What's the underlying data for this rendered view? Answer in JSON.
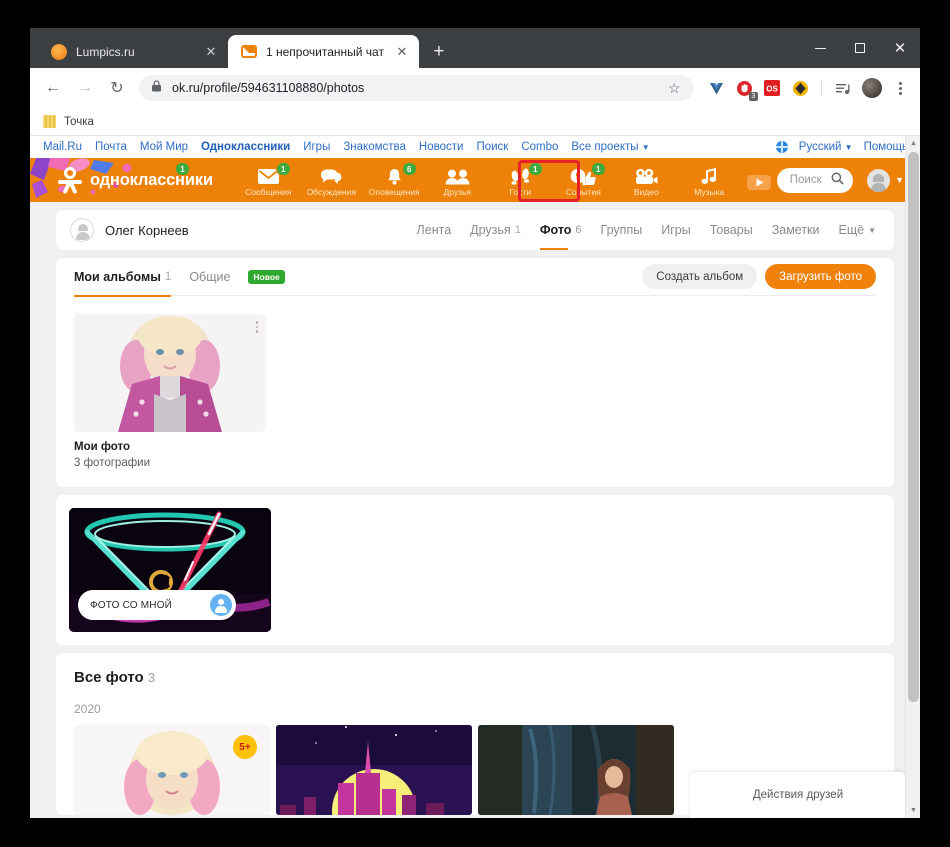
{
  "browser": {
    "tabs": [
      {
        "title": "Lumpics.ru",
        "favicon": "lumpics-favicon",
        "active": false,
        "close_label": "✕"
      },
      {
        "title": "1 непрочитанный чат",
        "favicon": "mail-envelope-favicon",
        "active": true,
        "close_label": "✕"
      }
    ],
    "new_tab_label": "+",
    "window_controls": {
      "minimize": "—",
      "maximize": "❐",
      "close": "✕"
    },
    "toolbar": {
      "back": "←",
      "forward": "→",
      "reload": "↻",
      "url": "ok.ru/profile/594631108880/photos",
      "lock_icon": "lock-icon",
      "star_icon": "☆",
      "extensions": [
        {
          "name": "vue-devtools-extension",
          "badge": ""
        },
        {
          "name": "adblock-extension",
          "badge": "3"
        },
        {
          "name": "os-extension",
          "badge": ""
        },
        {
          "name": "evernote-extension",
          "badge": ""
        }
      ],
      "media_icon": "media-list-icon",
      "menu_icon": "three-dot-menu-icon"
    },
    "bookmarks": [
      {
        "label": "Точка"
      }
    ]
  },
  "mailru_bar": {
    "links": [
      {
        "label": "Mail.Ru",
        "bold": false
      },
      {
        "label": "Почта",
        "bold": false
      },
      {
        "label": "Мой Мир",
        "bold": false
      },
      {
        "label": "Одноклассники",
        "bold": true
      },
      {
        "label": "Игры",
        "bold": false
      },
      {
        "label": "Знакомства",
        "bold": false
      },
      {
        "label": "Новости",
        "bold": false
      },
      {
        "label": "Поиск",
        "bold": false
      },
      {
        "label": "Combo",
        "bold": false
      },
      {
        "label": "Все проекты",
        "bold": false
      }
    ],
    "all_projects_caret": "▼",
    "language": "Русский",
    "language_caret": "▼",
    "help": "Помощь"
  },
  "ok_header": {
    "logo_text": "одноклассники",
    "logo_badge": "1",
    "nav": [
      {
        "label": "Сообщения",
        "icon": "envelope-icon",
        "badge": "1"
      },
      {
        "label": "Обсуждения",
        "icon": "chat-bubble-icon",
        "badge": ""
      },
      {
        "label": "Оповещения",
        "icon": "bell-icon",
        "badge": "6"
      },
      {
        "label": "Друзья",
        "icon": "people-icon",
        "badge": ""
      },
      {
        "label": "Гости",
        "icon": "footprints-icon",
        "badge": "1"
      },
      {
        "label": "События",
        "icon": "events-thumbsup-icon",
        "badge": "1"
      },
      {
        "label": "Видео",
        "icon": "video-camera-icon",
        "badge": ""
      },
      {
        "label": "Музыка",
        "icon": "music-note-icon",
        "badge": ""
      }
    ],
    "play_icon": "play-button-icon",
    "search_placeholder": "Поиск",
    "search_icon": "search-icon",
    "user_caret": "▼",
    "highlight_target": "События",
    "highlight_color": "#e8202a",
    "brand_color": "#ee8208"
  },
  "profile": {
    "name": "Олег Корнеев",
    "tabs": [
      {
        "label": "Лента",
        "count": "",
        "active": false,
        "caret": ""
      },
      {
        "label": "Друзья",
        "count": "1",
        "active": false,
        "caret": ""
      },
      {
        "label": "Фото",
        "count": "6",
        "active": true,
        "caret": ""
      },
      {
        "label": "Группы",
        "count": "",
        "active": false,
        "caret": ""
      },
      {
        "label": "Игры",
        "count": "",
        "active": false,
        "caret": ""
      },
      {
        "label": "Товары",
        "count": "",
        "active": false,
        "caret": ""
      },
      {
        "label": "Заметки",
        "count": "",
        "active": false,
        "caret": ""
      },
      {
        "label": "Ещё",
        "count": "",
        "active": false,
        "caret": "▼"
      }
    ]
  },
  "albums": {
    "tabs": [
      {
        "label": "Мои альбомы",
        "count": "1",
        "active": true
      },
      {
        "label": "Общие",
        "count": "",
        "active": false
      }
    ],
    "new_badge": "Новое",
    "create_album_button": "Создать альбом",
    "upload_photo_button": "Загрузить фото",
    "tile": {
      "title": "Мои фото",
      "count": "3 фотографии",
      "menu_icon": "album-kebab-menu-icon"
    }
  },
  "photos_with_me": {
    "pill_label": "ФОТО СО МНОЙ",
    "pill_icon": "person-tag-icon"
  },
  "all_photos": {
    "title": "Все фото",
    "count": "3",
    "year": "2020",
    "tiles": [
      {
        "name": "photo-blonde-woman",
        "badge": "5+"
      },
      {
        "name": "photo-city-skyline-moon",
        "badge": ""
      },
      {
        "name": "photo-forest-woman",
        "badge": ""
      }
    ]
  },
  "friends_panel": {
    "title": "Действия друзей"
  },
  "scrollbar": {
    "up_arrow": "▲",
    "down_arrow": "▼"
  }
}
